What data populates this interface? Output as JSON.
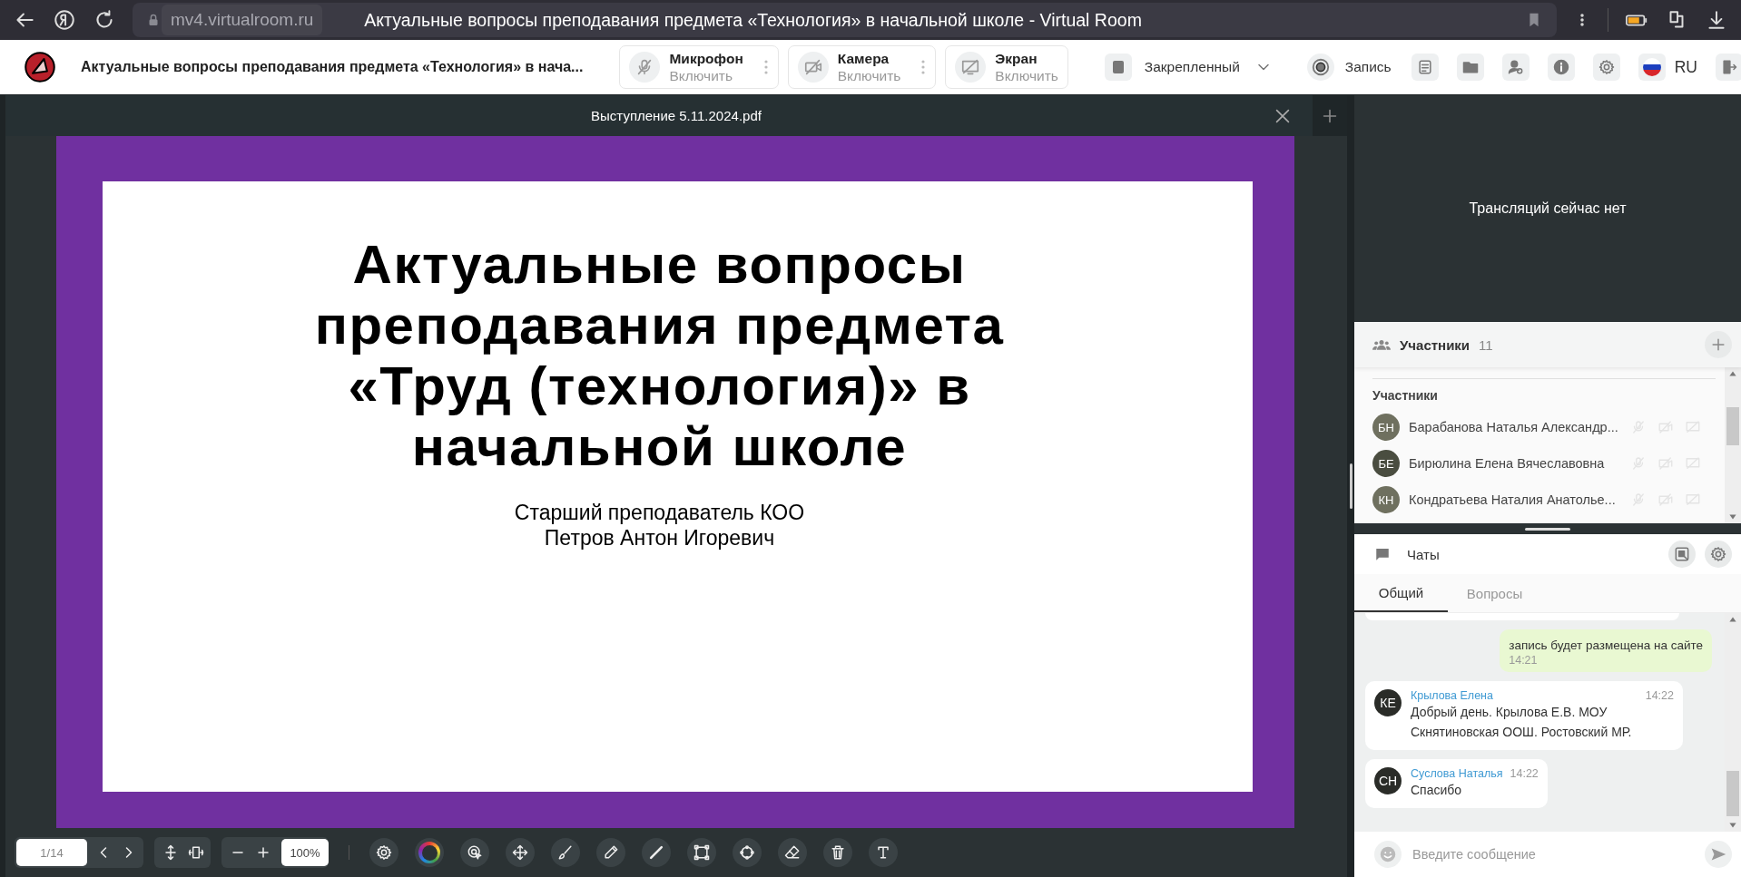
{
  "browser": {
    "url": "mv4.virtualroom.ru",
    "title": "Актуальные вопросы преподавания предмета «Технология» в начальной школе - Virtual Room"
  },
  "header": {
    "title": "Актуальные вопросы преподавания предмета «Технология» в нача...",
    "media": [
      {
        "kind": "mic",
        "label": "Микрофон",
        "action": "Включить",
        "menu": true
      },
      {
        "kind": "camera",
        "label": "Камера",
        "action": "Включить",
        "menu": true
      },
      {
        "kind": "screen",
        "label": "Экран",
        "action": "Включить",
        "menu": false
      }
    ],
    "layout": "Закрепленный",
    "record": "Запись",
    "language": "RU"
  },
  "viewer": {
    "file": "Выступление 5.11.2024.pdf",
    "slide": {
      "title": "Актуальные вопросы\nпреподавания предмета\n«Труд (технология)» в\nначальной школе",
      "subtitle": "Старший преподаватель КОО\nПетров Антон Игоревич"
    },
    "page": "1/14",
    "zoom": "100%",
    "tools": [
      {
        "kind": "settings"
      },
      {
        "kind": "color"
      },
      {
        "kind": "pointer"
      },
      {
        "kind": "move"
      },
      {
        "kind": "brush"
      },
      {
        "kind": "pencil"
      },
      {
        "kind": "line"
      },
      {
        "kind": "rect"
      },
      {
        "kind": "circle"
      },
      {
        "kind": "eraser"
      },
      {
        "kind": "trash"
      },
      {
        "kind": "text"
      }
    ]
  },
  "broadcast": {
    "message": "Трансляций сейчас нет"
  },
  "participants": {
    "title": "Участники",
    "count": "11",
    "group": "Участники",
    "items": [
      {
        "initials": "БН",
        "name": "Барабанова Наталья Александр...",
        "color": "#6f705f"
      },
      {
        "initials": "БЕ",
        "name": "Бирюлина Елена Вячеславовна",
        "color": "#4a4d40"
      },
      {
        "initials": "КН",
        "name": "Кондратьева Наталия Анатолье...",
        "color": "#6f705f"
      }
    ]
  },
  "chat": {
    "title": "Чаты",
    "tabs": [
      {
        "label": "Общий",
        "selected": true
      },
      {
        "label": "Вопросы",
        "selected": false
      }
    ],
    "messages": [
      {
        "kind": "own",
        "text": "запись будет размещена на сайте",
        "time": "14:21"
      },
      {
        "kind": "other",
        "initials": "КЕ",
        "author": "Крылова Елена",
        "time": "14:22",
        "text": "Добрый день. Крылова Е.В. МОУ Скнятиновская ООШ. Ростовский МР."
      },
      {
        "kind": "other",
        "initials": "СН",
        "author": "Суслова Наталья",
        "time": "14:22",
        "text": "Спасибо"
      }
    ],
    "placeholder": "Введите сообщение"
  }
}
